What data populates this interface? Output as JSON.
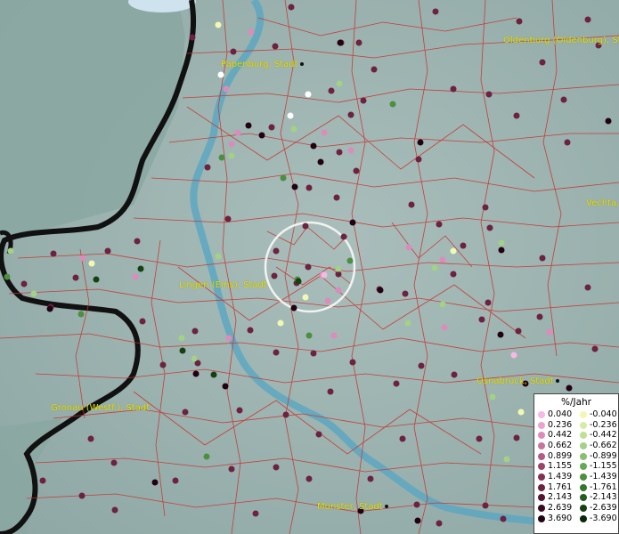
{
  "cities": [
    {
      "id": "papenburg",
      "label": "Papenburg, Stadt"
    },
    {
      "id": "oldenburg",
      "label": "Oldenburg (Oldenburg), Stadt"
    },
    {
      "id": "vechta",
      "label": "Vechta, Stadt"
    },
    {
      "id": "lingen",
      "label": "Lingen (Ems), Stadt"
    },
    {
      "id": "osnabrueck",
      "label": "Osnabrück, Stadt"
    },
    {
      "id": "gronau",
      "label": "Gronau (Westf.), Stadt"
    },
    {
      "id": "muenster",
      "label": "Münster, Stadt"
    }
  ],
  "legend": {
    "title": "%/Jahr",
    "rows": [
      {
        "pos": "0.040",
        "pos_color": "#f6b8e4",
        "neg": "-0.040",
        "neg_color": "#f2f7b4"
      },
      {
        "pos": "0.236",
        "pos_color": "#eca2d0",
        "neg": "-0.236",
        "neg_color": "#d6eca6"
      },
      {
        "pos": "0.442",
        "pos_color": "#dc8cbb",
        "neg": "-0.442",
        "neg_color": "#bfe096"
      },
      {
        "pos": "0.662",
        "pos_color": "#c9749f",
        "neg": "-0.662",
        "neg_color": "#a3d185"
      },
      {
        "pos": "0.899",
        "pos_color": "#b55a84",
        "neg": "-0.899",
        "neg_color": "#87c06f"
      },
      {
        "pos": "1.155",
        "pos_color": "#9c4468",
        "neg": "-1.155",
        "neg_color": "#66a856"
      },
      {
        "pos": "1.439",
        "pos_color": "#843151",
        "neg": "-1.439",
        "neg_color": "#4d8f40"
      },
      {
        "pos": "1.761",
        "pos_color": "#6c2240",
        "neg": "-1.761",
        "neg_color": "#36752d"
      },
      {
        "pos": "2.143",
        "pos_color": "#531530",
        "neg": "-2.143",
        "neg_color": "#245b1e"
      },
      {
        "pos": "2.639",
        "pos_color": "#3a0a20",
        "neg": "-2.639",
        "neg_color": "#154112"
      },
      {
        "pos": "3.690",
        "pos_color": "#220212",
        "neg": "-3.690",
        "neg_color": "#082809"
      }
    ]
  }
}
